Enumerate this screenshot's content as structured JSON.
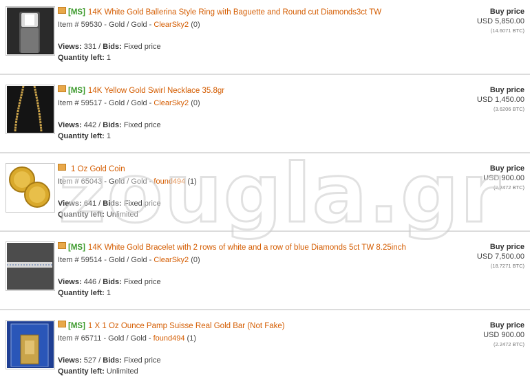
{
  "listings": [
    {
      "ms": "[MS]",
      "title": "14K White Gold Ballerina Style Ring with Baguette and Round cut Diamonds3ct TW",
      "item_prefix": "Item # 59530 - Gold / Gold - ",
      "seller": "ClearSky2",
      "rating": " (0)",
      "views": "331",
      "bids": "Fixed price",
      "quantity": "1",
      "price_type": "Buy price",
      "price_usd": "USD 5,850.00",
      "price_btc": "(14.6071 BTC)",
      "image": "ring"
    },
    {
      "ms": "[MS]",
      "title": "14K Yellow Gold Swirl Necklace 35.8gr",
      "item_prefix": "Item # 59517 - Gold / Gold - ",
      "seller": "ClearSky2",
      "rating": " (0)",
      "views": "442",
      "bids": "Fixed price",
      "quantity": "1",
      "price_type": "Buy price",
      "price_usd": "USD 1,450.00",
      "price_btc": "(3.6206 BTC)",
      "image": "necklace"
    },
    {
      "ms": "",
      "title": "1 Oz Gold Coin",
      "item_prefix": "Item # 65043 - Gold / Gold - ",
      "seller": "found494",
      "rating": " (1)",
      "views": "641",
      "bids": "Fixed price",
      "quantity": "Unlimited",
      "price_type": "Buy price",
      "price_usd": "USD 900.00",
      "price_btc": "(2.2472 BTC)",
      "image": "coins"
    },
    {
      "ms": "[MS]",
      "title": "14K White Gold Bracelet with 2 rows of white and a row of blue Diamonds 5ct TW 8.25inch",
      "item_prefix": "Item # 59514 - Gold / Gold - ",
      "seller": "ClearSky2",
      "rating": " (0)",
      "views": "446",
      "bids": "Fixed price",
      "quantity": "1",
      "price_type": "Buy price",
      "price_usd": "USD 7,500.00",
      "price_btc": "(18.7271 BTC)",
      "image": "bracelet"
    },
    {
      "ms": "[MS]",
      "title": "1 X 1 Oz Ounce Pamp Suisse Real Gold Bar (Not Fake)",
      "item_prefix": "Item # 65711 - Gold / Gold - ",
      "seller": "found494",
      "rating": " (1)",
      "views": "527",
      "bids": "Fixed price",
      "quantity": "Unlimited",
      "price_type": "Buy price",
      "price_usd": "USD 900.00",
      "price_btc": "(2.2472 BTC)",
      "image": "goldbar"
    }
  ],
  "labels": {
    "views": "Views:",
    "bids": "Bids:",
    "quantity": "Quantity left:",
    "slash": " / "
  },
  "watermark": "zougla.gr",
  "colors": {
    "title": "#d45c00",
    "ms": "#3c9a2c",
    "seller": "#d45c00"
  }
}
